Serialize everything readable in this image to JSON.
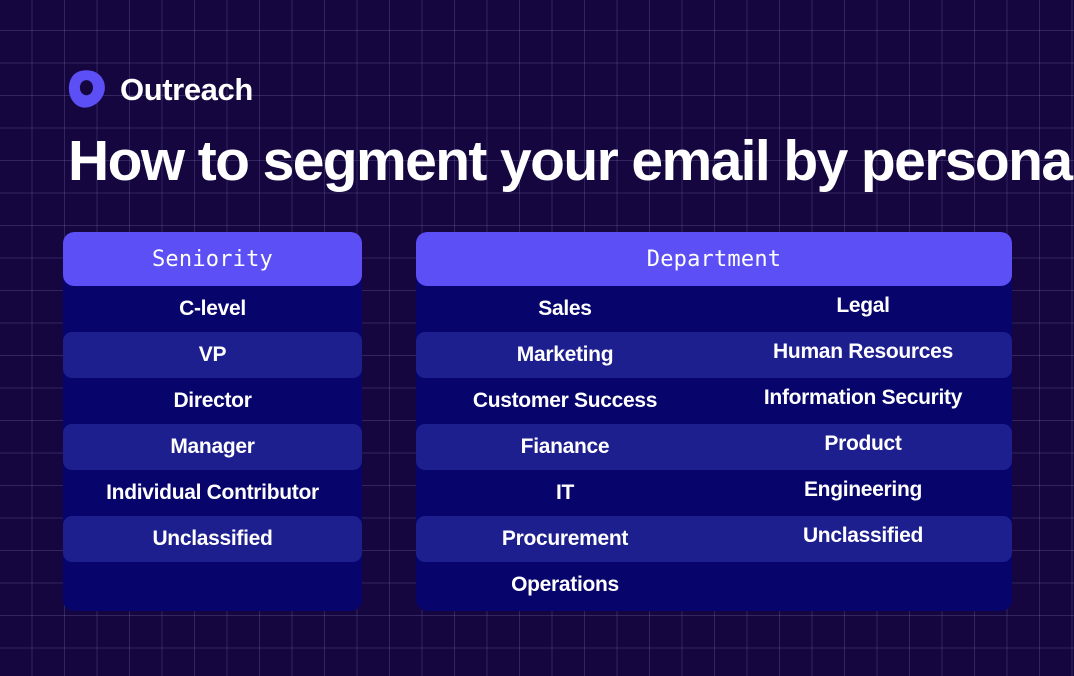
{
  "brand": {
    "name": "Outreach",
    "logo_icon": "outreach-blob-logo",
    "accent_color": "#5b4ff5"
  },
  "page": {
    "title": "How to segment your email by persona",
    "background_color": "#150640",
    "grid_line_color": "#968cd2"
  },
  "tables": [
    {
      "id": "seniority",
      "header": "Seniority",
      "header_background": "#5b4ff5",
      "body_background": "#07046c",
      "stripe_background": "#1e1f8f",
      "columns": 1,
      "rows": [
        {
          "primary": "C-level",
          "secondary": ""
        },
        {
          "primary": "VP",
          "secondary": ""
        },
        {
          "primary": "Director",
          "secondary": ""
        },
        {
          "primary": "Manager",
          "secondary": ""
        },
        {
          "primary": "Individual Contributor",
          "secondary": ""
        },
        {
          "primary": "Unclassified",
          "secondary": ""
        },
        {
          "primary": "",
          "secondary": ""
        }
      ]
    },
    {
      "id": "department",
      "header": "Department",
      "header_background": "#5b4ff5",
      "body_background": "#07046c",
      "stripe_background": "#1e1f8f",
      "columns": 2,
      "rows": [
        {
          "primary": "Sales",
          "secondary": "Legal"
        },
        {
          "primary": "Marketing",
          "secondary": "Human Resources"
        },
        {
          "primary": "Customer Success",
          "secondary": "Information Security"
        },
        {
          "primary": "Fianance",
          "secondary": "Product"
        },
        {
          "primary": "IT",
          "secondary": "Engineering"
        },
        {
          "primary": "Procurement",
          "secondary": "Unclassified"
        },
        {
          "primary": "Operations",
          "secondary": ""
        }
      ]
    }
  ]
}
